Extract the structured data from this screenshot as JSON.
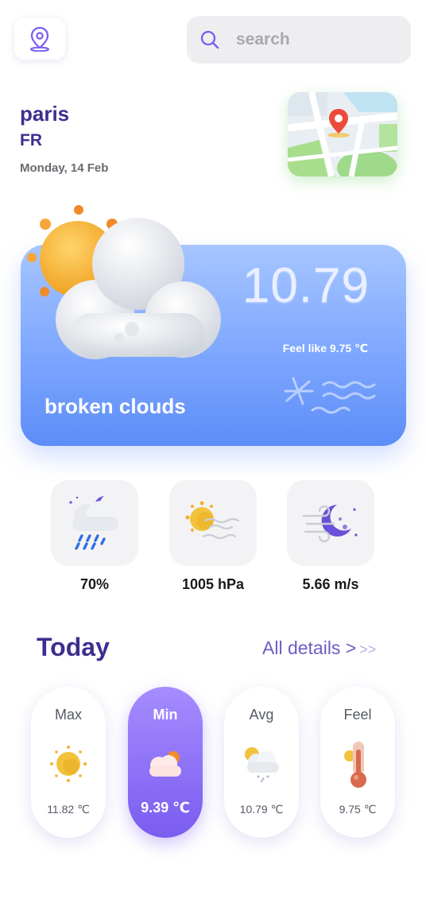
{
  "header": {
    "location_icon": "location-pin-icon",
    "search": {
      "placeholder": "search",
      "icon": "search-icon"
    }
  },
  "city": {
    "name": "paris",
    "country": "FR",
    "date": "Monday, 14 Feb"
  },
  "current": {
    "temperature": "10.79",
    "feel_like": "Feel like 9.75 ℃",
    "description": "broken clouds",
    "icon": "sun-behind-cloud-icon"
  },
  "metrics": [
    {
      "value": "70%",
      "icon": "night-rain-icon"
    },
    {
      "value": "1005 hPa",
      "icon": "sun-wind-icon"
    },
    {
      "value": "5.66 m/s",
      "icon": "moon-wind-icon"
    }
  ],
  "today": {
    "title": "Today",
    "all_details": "All details >",
    "arrows": ">>",
    "cards": [
      {
        "label": "Max",
        "value": "11.82 ℃",
        "icon": "sun-icon"
      },
      {
        "label": "Min",
        "value": "9.39 ℃",
        "icon": "cloud-sun-icon"
      },
      {
        "label": "Avg",
        "value": "10.79 ℃",
        "icon": "snow-cloud-icon"
      },
      {
        "label": "Feel",
        "value": "9.75 ℃",
        "icon": "thermometer-icon"
      }
    ]
  },
  "colors": {
    "accent": "#3c2f8f",
    "card_gradient_top": "#a7c6ff",
    "card_gradient_bottom": "#5d8df8",
    "highlight_pill": "#7a5cf0"
  }
}
